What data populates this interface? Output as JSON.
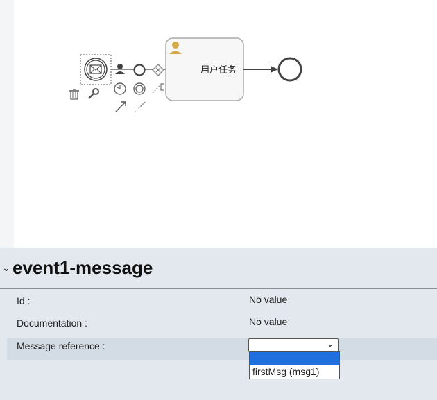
{
  "canvas": {
    "task_label": "用户任务"
  },
  "properties": {
    "title": "event1-message",
    "fields": [
      {
        "label": "Id :",
        "value": "No value"
      },
      {
        "label": "Documentation :",
        "value": "No value"
      },
      {
        "label": "Message reference :",
        "value": ""
      }
    ],
    "message_reference": {
      "selected": "",
      "options": [
        "",
        "firstMsg (msg1)"
      ]
    }
  },
  "colors": {
    "selection": "#1f6fde",
    "panel": "#e3e8ee",
    "task_icon": "#d4a94a"
  }
}
